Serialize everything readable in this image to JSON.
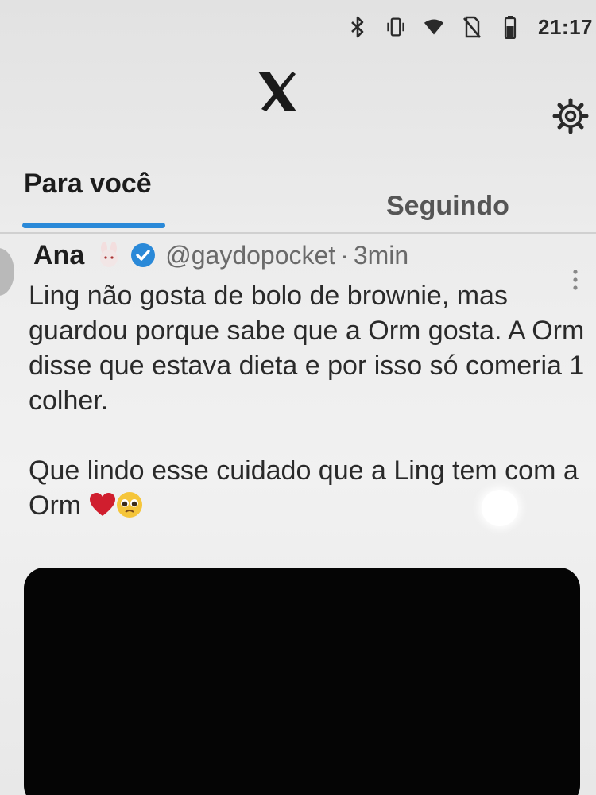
{
  "status_bar": {
    "time": "21:17",
    "icons": [
      "bluetooth-icon",
      "vibrate-icon",
      "wifi-icon",
      "no-sim-icon",
      "battery-icon"
    ]
  },
  "top_bar": {
    "logo": "x-logo",
    "settings_icon": "gear-icon"
  },
  "tabs": [
    {
      "label": "Para você",
      "active": true
    },
    {
      "label": "Seguindo",
      "active": false
    }
  ],
  "accent_color": "#2a89d8",
  "post": {
    "display_name": "Ana",
    "name_emoji": "bunny-emoji",
    "verified": true,
    "handle": "@gaydopocket",
    "separator": "·",
    "time": "3min",
    "paragraphs": [
      "Ling não gosta de bolo de brownie, mas guardou porque sabe que a Orm gosta. A Orm disse que estava dieta e por isso só comeria 1 colher.",
      "Que lindo esse cuidado que a Ling tem com a Orm"
    ],
    "trailing_emojis": [
      "red-heart-emoji",
      "pleading-face-emoji"
    ],
    "media": "dark-image"
  }
}
